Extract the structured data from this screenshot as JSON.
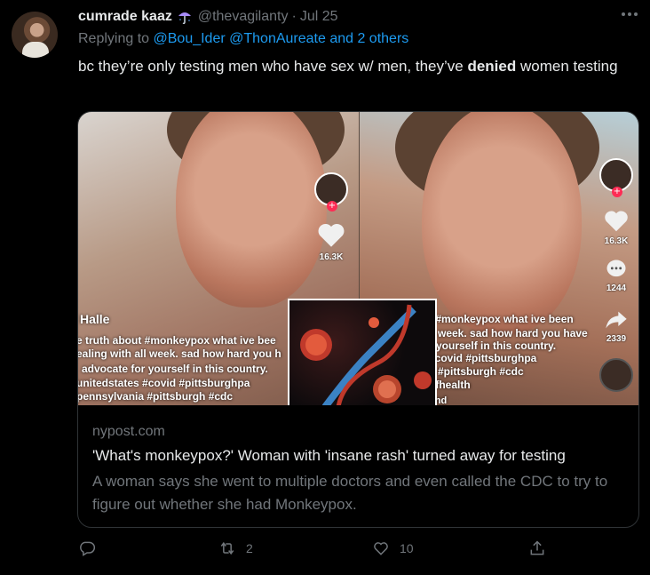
{
  "tweet": {
    "author_name": "cumrade kaaz",
    "handle": "@thevagilanty",
    "date": "Jul 25",
    "replying_prefix": "Replying to",
    "replying_to": "@Bou_Ider @ThonAureate and 2 others",
    "text_before": "bc they’re only testing men who have sex w/ men, they’ve ",
    "text_bold": "denied",
    "text_after": " women testing"
  },
  "media": {
    "left_overlay": {
      "likes": "16.3K",
      "name": "Halle",
      "lines": [
        "e truth about #monkeypox what ive bee",
        "ealing with all week. sad how hard you h",
        "advocate for yourself in this country.",
        "unitedstates #covid #pittsburghpa",
        "pennsylvania #pittsburgh #cdc"
      ]
    },
    "right_overlay": {
      "likes": "16.3K",
      "comments": "1244",
      "shares": "2339",
      "lines": [
        "t #monkeypox what ive been",
        "ll week. sad how hard you have",
        "r yourself in this country.",
        "#covid #pittsburghpa",
        "a #pittsburgh #cdc",
        "ofhealth",
        "und"
      ]
    }
  },
  "card": {
    "domain": "nypost.com",
    "title": "'What's monkeypox?' Woman with 'insane rash' turned away for testing",
    "description": "A woman says she went to multiple doctors and even called the CDC to try to figure out whether she had Monkeypox."
  },
  "actions": {
    "retweets": "2",
    "likes": "10"
  },
  "colors": {
    "background": "#000000",
    "text": "#e7e9ea",
    "secondary": "#71767b",
    "link": "#1d9bf0",
    "border": "#2f3336"
  }
}
